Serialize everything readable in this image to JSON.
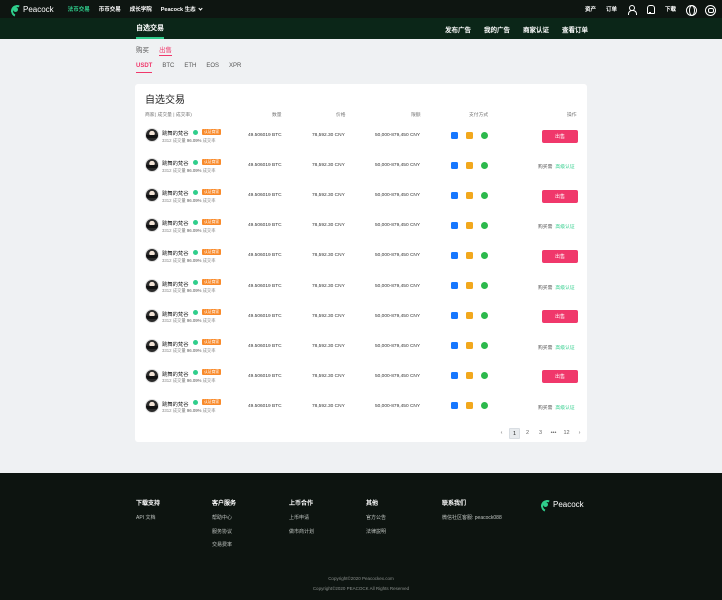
{
  "topnav": {
    "brand": "Peacock",
    "links": [
      "法币交易",
      "币币交易",
      "成长学院",
      "Peacock 生态"
    ],
    "right_links": [
      "资产",
      "订单"
    ],
    "download": "下载"
  },
  "subnav": {
    "title": "自选交易",
    "links": [
      "发布广告",
      "我的广告",
      "商家认证",
      "查看订单"
    ]
  },
  "trade_tabs": [
    "购买",
    "出售"
  ],
  "coin_tabs": [
    "USDT",
    "BTC",
    "ETH",
    "EOS",
    "XPR"
  ],
  "table": {
    "title": "自选交易",
    "headers": {
      "merchant": "商家( 成交量 | 成交率)",
      "amount": "数量",
      "price": "价格",
      "limit": "限额",
      "payment": "支付方式",
      "action": "操作"
    },
    "rows": [
      {
        "name": "跳舞的梵谷",
        "badge": "认证商家",
        "trades": "3312 成交量",
        "rate": "96.09%",
        "rate_label": "成交率",
        "amount": "49.506019 BTC",
        "price": "78,592.30 CNY",
        "limit": "50,000-879,450 CNY",
        "action": "出售"
      },
      {
        "name": "跳舞的梵谷",
        "badge": "认证商家",
        "trades": "3312 成交量",
        "rate": "96.09%",
        "rate_label": "成交率",
        "amount": "49.506019 BTC",
        "price": "78,592.30 CNY",
        "limit": "50,000-879,450 CNY",
        "note": "购买需",
        "note_link": "高级认证"
      },
      {
        "name": "跳舞的梵谷",
        "badge": "认证商家",
        "trades": "3312 成交量",
        "rate": "96.09%",
        "rate_label": "成交率",
        "amount": "49.506019 BTC",
        "price": "78,592.30 CNY",
        "limit": "50,000-879,450 CNY",
        "action": "出售"
      },
      {
        "name": "跳舞的梵谷",
        "badge": "认证商家",
        "trades": "3312 成交量",
        "rate": "96.09%",
        "rate_label": "成交率",
        "amount": "49.506019 BTC",
        "price": "78,592.30 CNY",
        "limit": "50,000-879,450 CNY",
        "note": "购买需",
        "note_link": "高级认证"
      },
      {
        "name": "跳舞的梵谷",
        "badge": "认证商家",
        "trades": "3312 成交量",
        "rate": "96.09%",
        "rate_label": "成交率",
        "amount": "49.506019 BTC",
        "price": "78,592.30 CNY",
        "limit": "50,000-879,450 CNY",
        "action": "出售"
      },
      {
        "name": "跳舞的梵谷",
        "badge": "认证商家",
        "trades": "3312 成交量",
        "rate": "96.09%",
        "rate_label": "成交率",
        "amount": "49.506019 BTC",
        "price": "78,592.30 CNY",
        "limit": "50,000-879,450 CNY",
        "note": "购买需",
        "note_link": "高级认证"
      },
      {
        "name": "跳舞的梵谷",
        "badge": "认证商家",
        "trades": "3312 成交量",
        "rate": "96.09%",
        "rate_label": "成交率",
        "amount": "49.506019 BTC",
        "price": "78,592.30 CNY",
        "limit": "50,000-879,450 CNY",
        "action": "出售"
      },
      {
        "name": "跳舞的梵谷",
        "badge": "认证商家",
        "trades": "3312 成交量",
        "rate": "96.09%",
        "rate_label": "成交率",
        "amount": "49.506019 BTC",
        "price": "78,592.30 CNY",
        "limit": "50,000-879,450 CNY",
        "note": "购买需",
        "note_link": "高级认证"
      },
      {
        "name": "跳舞的梵谷",
        "badge": "认证商家",
        "trades": "3312 成交量",
        "rate": "96.09%",
        "rate_label": "成交率",
        "amount": "49.506019 BTC",
        "price": "78,592.30 CNY",
        "limit": "50,000-879,450 CNY",
        "action": "出售"
      },
      {
        "name": "跳舞的梵谷",
        "badge": "认证商家",
        "trades": "3312 成交量",
        "rate": "96.09%",
        "rate_label": "成交率",
        "amount": "49.506019 BTC",
        "price": "78,592.30 CNY",
        "limit": "50,000-879,450 CNY",
        "note": "购买需",
        "note_link": "高级认证"
      }
    ],
    "payment_icons": [
      "alipay-icon",
      "bank-card-icon",
      "wechat-pay-icon"
    ]
  },
  "pagination": {
    "pages": [
      "1",
      "2",
      "3",
      "•••",
      "12"
    ],
    "current": "1"
  },
  "footer": {
    "columns": [
      {
        "title": "下载支持",
        "items": [
          "API 文档"
        ]
      },
      {
        "title": "客户服务",
        "items": [
          "帮助中心",
          "服务协议",
          "交易费率"
        ]
      },
      {
        "title": "上币合作",
        "items": [
          "上币申请",
          "做市商计划"
        ]
      },
      {
        "title": "其他",
        "items": [
          "官方公告",
          "法律説明"
        ]
      },
      {
        "title": "联系我们",
        "items": [
          "微信社区客服: peacock088"
        ]
      }
    ],
    "brand": "Peacock",
    "copyright_1": "Copyright©2020 Peacockex.com",
    "copyright_2": "Copyright©2020 PEACOCK All Rights Reserved"
  },
  "colors": {
    "accent_green": "#2fce8c",
    "accent_pink": "#f0386b",
    "badge_orange": "#f98a2a",
    "nav_bg": "#0e1511",
    "subnav_bg": "#0b2618"
  }
}
